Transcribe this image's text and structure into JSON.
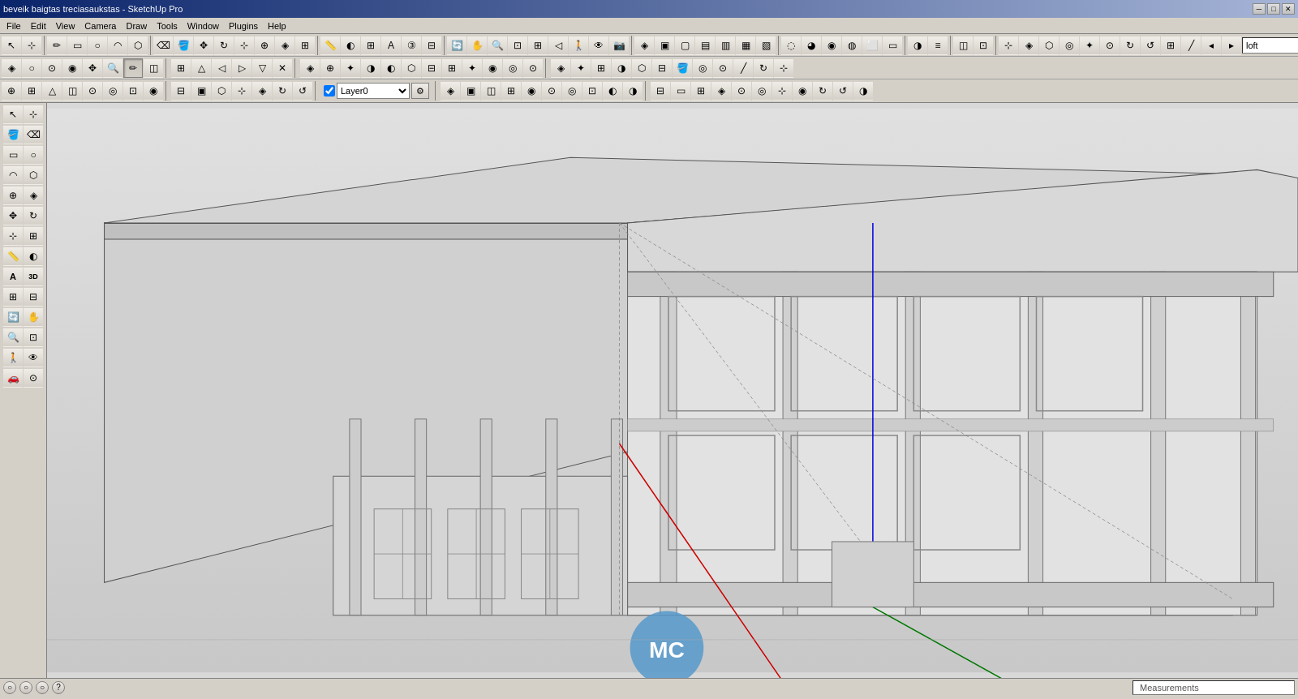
{
  "title_bar": {
    "title": "beveik baigtas treciasaukstas - SketchUp Pro",
    "min_btn": "─",
    "max_btn": "□",
    "close_btn": "✕"
  },
  "menu": {
    "items": [
      "File",
      "Edit",
      "View",
      "Camera",
      "Draw",
      "Tools",
      "Window",
      "Plugins",
      "Help"
    ]
  },
  "toolbar_rows": {
    "row1_tools": [
      "↖",
      "✏",
      "▭",
      "○",
      "◠",
      "⬡",
      "⌫",
      "🪣",
      "✥",
      "↻",
      "⊹",
      "⊕",
      "📏",
      "A",
      "⊞",
      "◈",
      "👁",
      "◑",
      "═",
      "⊟",
      "⊕"
    ],
    "row2_tools": [
      "◈",
      "○",
      "⊙",
      "◉",
      "✥",
      "🔍",
      "✏",
      "◫"
    ],
    "row3_tools": [
      "◈",
      "△",
      "▣",
      "□",
      "□",
      "□"
    ],
    "row4_tools": [
      "◎",
      "◑",
      "◔",
      "◓",
      "◒"
    ],
    "row5_tools": [
      "↩",
      "↪",
      "⊟",
      "▣",
      "◫",
      "✕",
      "◈",
      "⊞",
      "◑",
      "⊹",
      "□",
      "◫"
    ],
    "layer_label": "Layer0",
    "layer_dropdown_options": [
      "Layer0"
    ],
    "loft_value": "loft"
  },
  "row3_tools2": [
    "⬡",
    "△",
    "▣",
    "▤",
    "⊞",
    "◫"
  ],
  "left_toolbar": {
    "tools": [
      {
        "name": "select",
        "icon": "↖"
      },
      {
        "name": "component-select",
        "icon": "⊹"
      },
      {
        "name": "paint",
        "icon": "🪣"
      },
      {
        "name": "eraser",
        "icon": "⌫"
      },
      {
        "name": "rect",
        "icon": "▭"
      },
      {
        "name": "circle",
        "icon": "○"
      },
      {
        "name": "arc",
        "icon": "◠"
      },
      {
        "name": "push-pull",
        "icon": "⊕"
      },
      {
        "name": "move",
        "icon": "✥"
      },
      {
        "name": "rotate",
        "icon": "↻"
      },
      {
        "name": "scale",
        "icon": "⊹"
      },
      {
        "name": "line",
        "icon": "╱"
      },
      {
        "name": "tape",
        "icon": "◌"
      },
      {
        "name": "text",
        "icon": "A"
      },
      {
        "name": "axes",
        "icon": "⊞"
      },
      {
        "name": "orbit",
        "icon": "🔄"
      },
      {
        "name": "pan",
        "icon": "✋"
      },
      {
        "name": "zoom",
        "icon": "🔍"
      },
      {
        "name": "zoom-window",
        "icon": "⊡"
      },
      {
        "name": "walk",
        "icon": "🚶"
      },
      {
        "name": "look-around",
        "icon": "◉"
      },
      {
        "name": "section-plane",
        "icon": "⊟"
      },
      {
        "name": "measure",
        "icon": "📐"
      }
    ]
  },
  "scene": {
    "bg_color": "#d5d5d5",
    "axis_red_visible": true,
    "axis_blue_visible": true,
    "axis_green_visible": true,
    "mc_logo_visible": true
  },
  "bottom_bar": {
    "status_icons": [
      "○",
      "○",
      "○",
      "?"
    ],
    "measurements_label": "Measurements",
    "measurements_value": ""
  }
}
